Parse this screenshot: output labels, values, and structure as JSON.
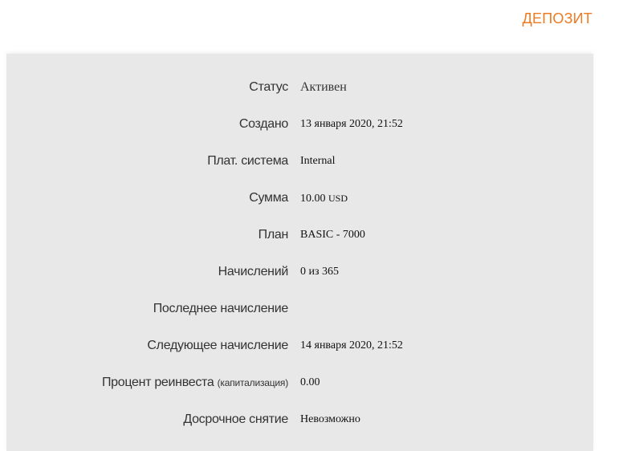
{
  "header": {
    "title": "ДЕПОЗИТ"
  },
  "deposit": {
    "rows": [
      {
        "label": "Статус",
        "value": "Активен"
      },
      {
        "label": "Создано",
        "value": "13 января 2020, 21:52"
      },
      {
        "label": "Плат. система",
        "value": "Internal"
      },
      {
        "label": "Сумма",
        "value": "10.00",
        "unit": "USD"
      },
      {
        "label": "План",
        "value": "BASIC - 7000"
      },
      {
        "label": "Начислений",
        "value": "0 из 365"
      },
      {
        "label": "Последнее начисление",
        "value": ""
      },
      {
        "label": "Следующее начисление",
        "value": "14 января 2020, 21:52"
      },
      {
        "label": "Процент реинвеста",
        "label_note": "(капитализация)",
        "value": "0.00"
      },
      {
        "label": "Досрочное снятие",
        "value": "Невозможно"
      }
    ]
  }
}
